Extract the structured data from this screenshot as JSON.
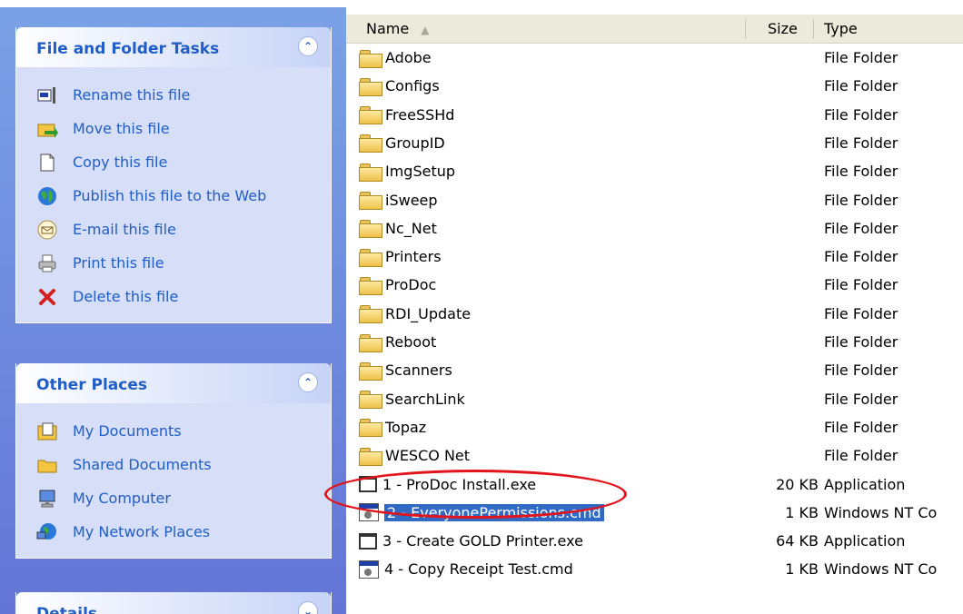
{
  "task_pane": {
    "file_tasks": {
      "title": "File and Folder Tasks",
      "items": [
        {
          "label": "Rename this file",
          "icon": "rename-icon"
        },
        {
          "label": "Move this file",
          "icon": "move-icon"
        },
        {
          "label": "Copy this file",
          "icon": "copy-icon"
        },
        {
          "label": "Publish this file to the Web",
          "icon": "globe-icon"
        },
        {
          "label": "E-mail this file",
          "icon": "email-icon"
        },
        {
          "label": "Print this file",
          "icon": "printer-icon"
        },
        {
          "label": "Delete this file",
          "icon": "delete-icon"
        }
      ]
    },
    "other_places": {
      "title": "Other Places",
      "items": [
        {
          "label": "My Documents",
          "icon": "my-documents-icon"
        },
        {
          "label": "Shared Documents",
          "icon": "folder-icon"
        },
        {
          "label": "My Computer",
          "icon": "computer-icon"
        },
        {
          "label": "My Network Places",
          "icon": "network-icon"
        }
      ]
    },
    "details": {
      "title": "Details"
    }
  },
  "columns": {
    "name": "Name",
    "size": "Size",
    "type": "Type"
  },
  "files": [
    {
      "name": "Adobe",
      "size": "",
      "type": "File Folder",
      "kind": "folder"
    },
    {
      "name": "Configs",
      "size": "",
      "type": "File Folder",
      "kind": "folder"
    },
    {
      "name": "FreeSSHd",
      "size": "",
      "type": "File Folder",
      "kind": "folder"
    },
    {
      "name": "GroupID",
      "size": "",
      "type": "File Folder",
      "kind": "folder"
    },
    {
      "name": "ImgSetup",
      "size": "",
      "type": "File Folder",
      "kind": "folder"
    },
    {
      "name": "iSweep",
      "size": "",
      "type": "File Folder",
      "kind": "folder"
    },
    {
      "name": "Nc_Net",
      "size": "",
      "type": "File Folder",
      "kind": "folder"
    },
    {
      "name": "Printers",
      "size": "",
      "type": "File Folder",
      "kind": "folder"
    },
    {
      "name": "ProDoc",
      "size": "",
      "type": "File Folder",
      "kind": "folder"
    },
    {
      "name": "RDI_Update",
      "size": "",
      "type": "File Folder",
      "kind": "folder"
    },
    {
      "name": "Reboot",
      "size": "",
      "type": "File Folder",
      "kind": "folder"
    },
    {
      "name": "Scanners",
      "size": "",
      "type": "File Folder",
      "kind": "folder"
    },
    {
      "name": "SearchLink",
      "size": "",
      "type": "File Folder",
      "kind": "folder"
    },
    {
      "name": "Topaz",
      "size": "",
      "type": "File Folder",
      "kind": "folder"
    },
    {
      "name": "WESCO Net",
      "size": "",
      "type": "File Folder",
      "kind": "folder"
    },
    {
      "name": "1 - ProDoc Install.exe",
      "size": "20 KB",
      "type": "Application",
      "kind": "exe"
    },
    {
      "name": "2 - EveryonePermissions.cmd",
      "size": "1 KB",
      "type": "Windows NT Co",
      "kind": "cmd",
      "selected": true
    },
    {
      "name": "3 - Create GOLD Printer.exe",
      "size": "64 KB",
      "type": "Application",
      "kind": "exe"
    },
    {
      "name": "4 - Copy Receipt Test.cmd",
      "size": "1 KB",
      "type": "Windows NT Co",
      "kind": "cmd"
    }
  ],
  "colors": {
    "highlight_circle": "#e2141c",
    "selection": "#316ac5",
    "task_link": "#215dc6"
  }
}
